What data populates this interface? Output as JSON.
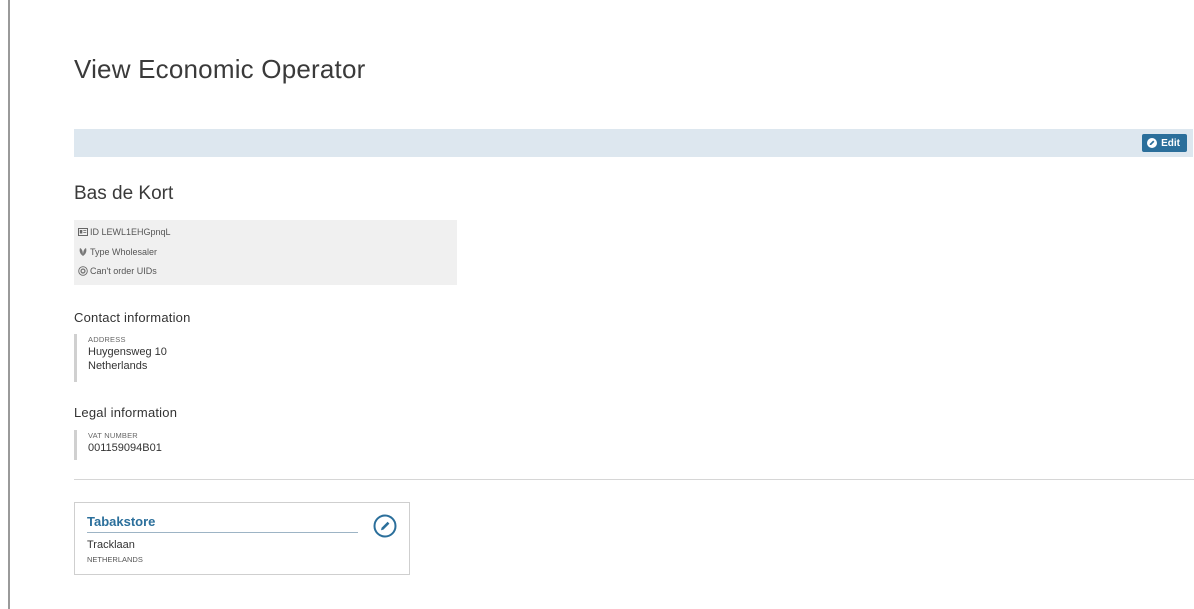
{
  "page": {
    "title": "View Economic Operator"
  },
  "toolbar": {
    "edit_label": "Edit"
  },
  "operator": {
    "name": "Bas de Kort",
    "meta": [
      {
        "icon": "id-card-icon",
        "text": "ID LEWL1EHGpnqL"
      },
      {
        "icon": "leaf-icon",
        "text": "Type Wholesaler"
      },
      {
        "icon": "cancel-circle-icon",
        "text": "Can't order UIDs"
      }
    ]
  },
  "contact": {
    "heading": "Contact information",
    "address_label": "ADDRESS",
    "address_line1": "Huygensweg 10",
    "address_line2": "Netherlands"
  },
  "legal": {
    "heading": "Legal information",
    "vat_label": "VAT NUMBER",
    "vat_value": "001159094B01"
  },
  "facility": {
    "name": "Tabakstore",
    "street": "Tracklaan",
    "country": "NETHERLANDS",
    "edit_icon": "pencil-circle-icon"
  },
  "colors": {
    "accent": "#2b6f9b",
    "toolbar_bg": "#dde7ef",
    "meta_bg": "#f0f0f0"
  }
}
